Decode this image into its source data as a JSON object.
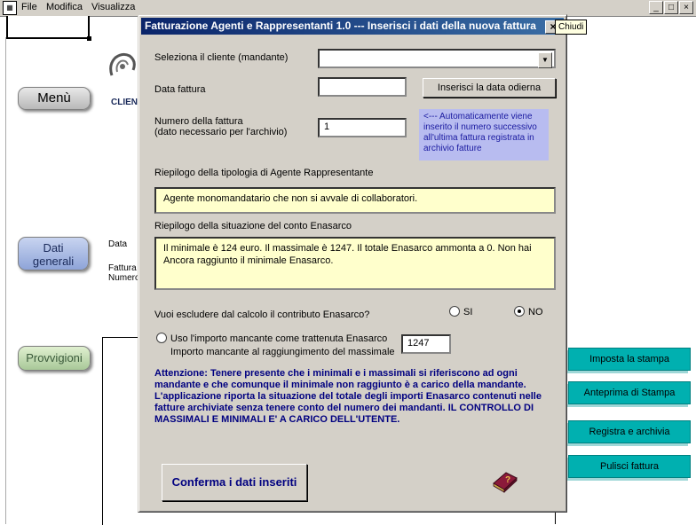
{
  "app": {
    "menu_items": [
      "File",
      "Modifica",
      "Visualizza"
    ],
    "window_buttons": [
      "_",
      "×"
    ]
  },
  "background": {
    "clien_label": "CLIEN",
    "data_label": "Data",
    "fattura_label": "Fattura",
    "numero_label": "Numero",
    "tooltip": "Chiudi",
    "side_buttons": {
      "menu": "Menù",
      "dati_line1": "Dati",
      "dati_line2": "generali",
      "provvigioni": "Provvigioni"
    },
    "right_buttons": [
      "Imposta la stampa",
      "Anteprima di Stampa",
      "Registra e archivia",
      "Pulisci fattura"
    ]
  },
  "dialog": {
    "title": "Fatturazione Agenti e Rappresentanti 1.0  --- Inserisci i dati della nuova fattura",
    "close_glyph": "×",
    "cliente_label": "Seleziona il cliente (mandante)",
    "cliente_value": "",
    "data_label": "Data fattura",
    "data_value": "",
    "data_button": "Inserisci la data odierna",
    "numero_label_1": "Numero della fattura",
    "numero_label_2": "(dato necessario per l'archivio)",
    "numero_value": "1",
    "numero_info": "<--- Automaticamente viene inserito il numero successivo all'ultima fattura registrata in archivio fatture",
    "tipologia_label": "Riepilogo della tipologia di Agente Rappresentante",
    "tipologia_value": "Agente  monomandatario che non si avvale di collaboratori.",
    "enasarco_label": "Riepilogo della situazione del conto Enasarco",
    "enasarco_value": "Il minimale è 124 euro. Il massimale è 1247. Il totale Enasarco ammonta a 0.  Non hai Ancora raggiunto il minimale Enasarco.",
    "escludere_label": "Vuoi escludere dal calcolo il contributo Enasarco?",
    "radio_si": "SI",
    "radio_no": "NO",
    "radio_selected": "NO",
    "uso_label": "Uso l'importo mancante come trattenuta Enasarco",
    "importo_label": "Importo mancante al raggiungimento del massimale",
    "importo_value": "1247",
    "warning": "Attenzione: Tenere presente che i minimali e i massimali  si riferiscono ad ogni mandante e che comunque il minimale non raggiunto è a carico della mandante.  L'applicazione riporta la situazione del totale degli importi Enasarco contenuti nelle fatture archiviate senza tenere conto del numero dei mandanti. IL CONTROLLO DI MASSIMALI E MINIMALI E' A CARICO DELL'UTENTE.",
    "confirm_button": "Conferma i dati inseriti"
  }
}
